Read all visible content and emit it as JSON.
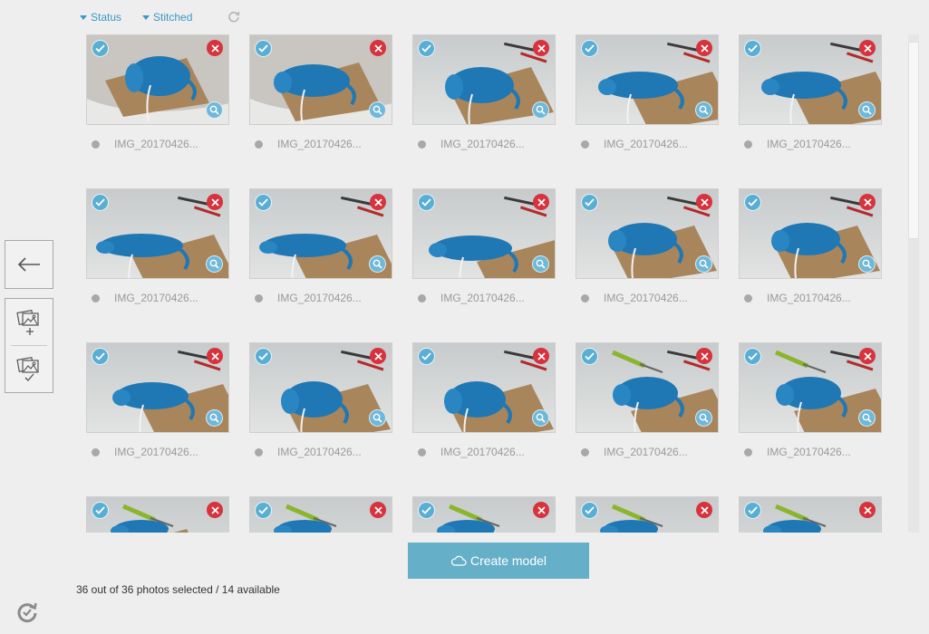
{
  "filters": {
    "status_label": "Status",
    "stitched_label": "Stitched",
    "refresh_icon": "refresh-icon"
  },
  "photos": [
    {
      "name": "IMG_20170426...",
      "checked": true,
      "view": 1
    },
    {
      "name": "IMG_20170426...",
      "checked": true,
      "view": 2
    },
    {
      "name": "IMG_20170426...",
      "checked": true,
      "view": 3
    },
    {
      "name": "IMG_20170426...",
      "checked": true,
      "view": 4
    },
    {
      "name": "IMG_20170426...",
      "checked": true,
      "view": 4
    },
    {
      "name": "IMG_20170426...",
      "checked": true,
      "view": 5
    },
    {
      "name": "IMG_20170426...",
      "checked": true,
      "view": 5
    },
    {
      "name": "IMG_20170426...",
      "checked": true,
      "view": 6
    },
    {
      "name": "IMG_20170426...",
      "checked": true,
      "view": 7
    },
    {
      "name": "IMG_20170426...",
      "checked": true,
      "view": 7
    },
    {
      "name": "IMG_20170426...",
      "checked": true,
      "view": 8
    },
    {
      "name": "IMG_20170426...",
      "checked": true,
      "view": 9
    },
    {
      "name": "IMG_20170426...",
      "checked": true,
      "view": 9
    },
    {
      "name": "IMG_20170426...",
      "checked": true,
      "view": 10
    },
    {
      "name": "IMG_20170426...",
      "checked": true,
      "view": 10
    },
    {
      "name": "",
      "checked": true,
      "view": 11
    },
    {
      "name": "",
      "checked": true,
      "view": 12
    },
    {
      "name": "",
      "checked": true,
      "view": 12
    },
    {
      "name": "",
      "checked": true,
      "view": 12
    },
    {
      "name": "",
      "checked": true,
      "view": 12
    }
  ],
  "sidebar": {
    "back_icon": "arrow-left-icon",
    "add_photos_icon": "add-photos-icon",
    "select_photos_icon": "select-photos-icon"
  },
  "actions": {
    "create_model_label": "Create model",
    "cloud_icon": "cloud-icon"
  },
  "status": {
    "selection_text": "36 out of 36 photos selected / 14 available"
  },
  "colors": {
    "accent": "#3b97c6",
    "check": "#5aaed3",
    "remove": "#d8323d",
    "create_button": "#65afc8",
    "model_blue": "#1f78b4",
    "mat_brown": "#a9855c"
  }
}
